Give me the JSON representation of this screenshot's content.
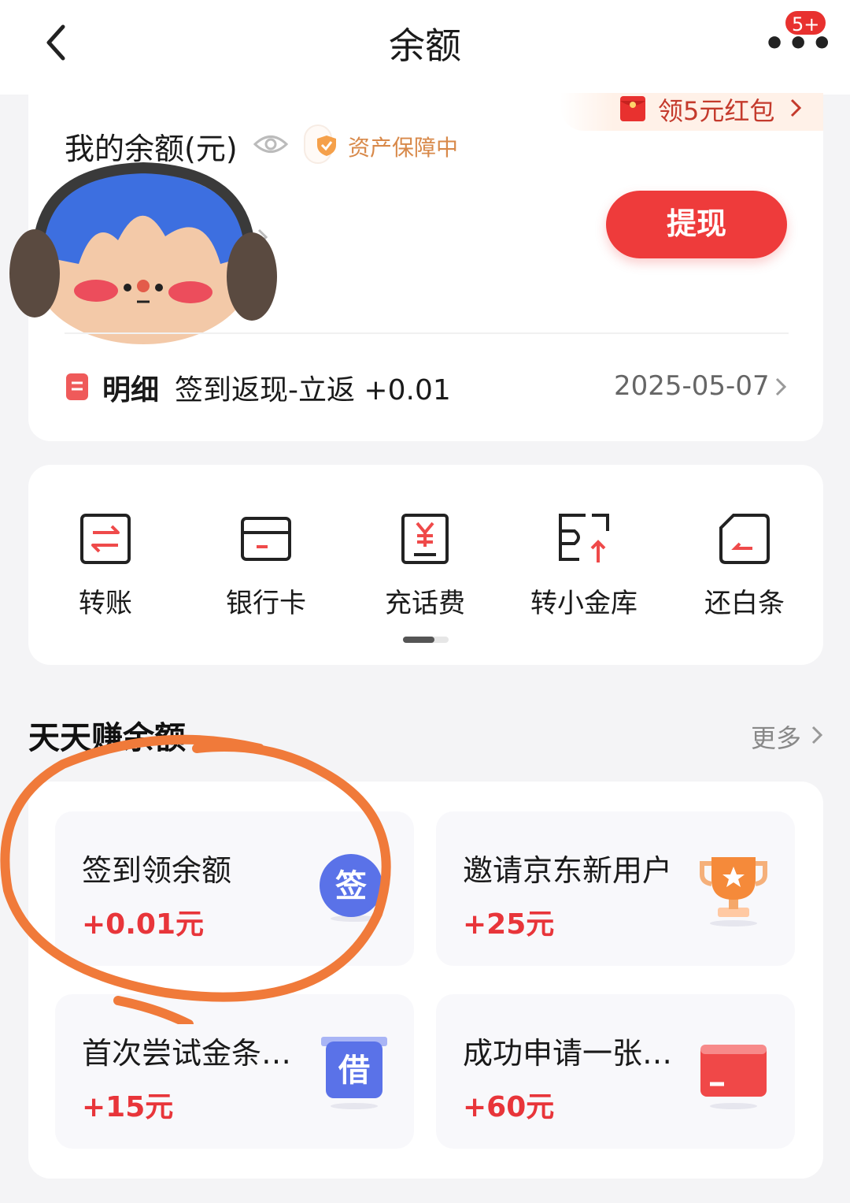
{
  "header": {
    "title": "余额",
    "badge": "5+",
    "more_dots": "•••"
  },
  "banner": {
    "redpacket_label": "领5元红包"
  },
  "balance": {
    "label": "我的余额(元)",
    "protect_label": "资产保障中",
    "withdraw_label": "提现"
  },
  "detail": {
    "label": "明细",
    "description": "签到返现-立返 +0.01",
    "date": "2025-05-07"
  },
  "actions": [
    {
      "label": "转账",
      "icon": "transfer-icon"
    },
    {
      "label": "银行卡",
      "icon": "bank-card-icon"
    },
    {
      "label": "充话费",
      "icon": "phone-recharge-icon"
    },
    {
      "label": "转小金库",
      "icon": "vault-transfer-icon"
    },
    {
      "label": "还白条",
      "icon": "repay-icon"
    }
  ],
  "earn": {
    "title": "天天赚余额",
    "more_label": "更多",
    "tasks": [
      {
        "title": "签到领余额",
        "reward": "+0.01元",
        "icon": "sign-in-icon",
        "icon_text": "签"
      },
      {
        "title": "邀请京东新用户",
        "reward": "+25元",
        "icon": "trophy-icon"
      },
      {
        "title": "首次尝试金条…",
        "reward": "+15元",
        "icon": "borrow-icon",
        "icon_text": "借"
      },
      {
        "title": "成功申请一张…",
        "reward": "+60元",
        "icon": "credit-card-icon"
      }
    ]
  },
  "colors": {
    "accent_red": "#ee3b3b",
    "reward_red": "#e8353a",
    "annotation_orange": "#f07a3a"
  }
}
